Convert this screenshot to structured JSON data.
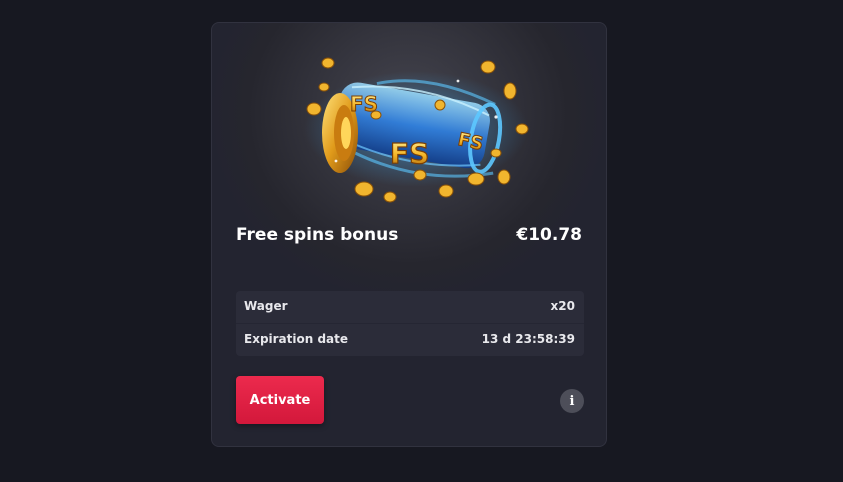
{
  "bonus": {
    "title": "Free spins bonus",
    "amount": "€10.78",
    "badge_text": "FS",
    "details": [
      {
        "label": "Wager",
        "value": "x20"
      },
      {
        "label": "Expiration date",
        "value": "13 d 23:58:39"
      }
    ],
    "activate_label": "Activate",
    "info_icon": "i"
  },
  "colors": {
    "page_background": "#171821",
    "card_background": "#26262e",
    "details_background": "#2b2c39",
    "accent": "#e3213f",
    "text": "#ffffff"
  },
  "icons": {
    "illustration": "free-spins-slot-reel-icon",
    "info": "info-icon"
  }
}
